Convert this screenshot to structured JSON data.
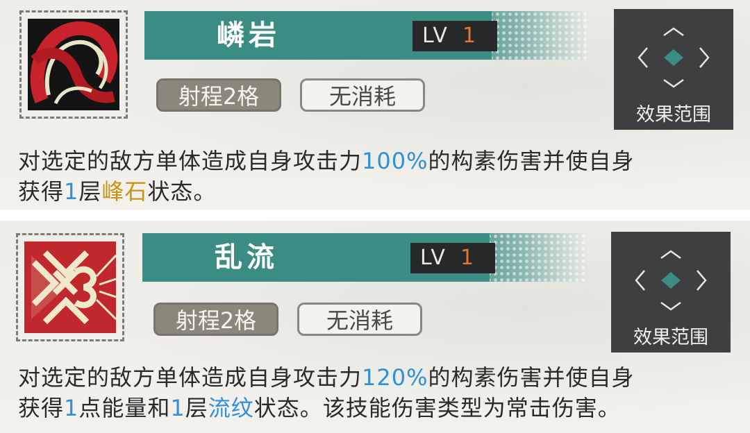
{
  "colors": {
    "banner": "#3b8c83",
    "highlight_blue": "#2f8fd8",
    "highlight_gold": "#c79513",
    "level_value": "#e5752f",
    "range_tile": "#3b8c83"
  },
  "skills": [
    {
      "icon": "red-swirl-icon",
      "name": "嶙岩",
      "level_label": "LV",
      "level_value": "1",
      "tags": {
        "range": "射程2格",
        "cost": "无消耗"
      },
      "range_label": "效果范围",
      "description": {
        "line1_part1": "对选定的敌方单体造成自身攻击力",
        "line1_pct": "100%",
        "line1_part2": "的构素伤害并使自身",
        "line2_part1": "获得",
        "line2_num": "1",
        "line2_part2": "层",
        "line2_status": "峰石",
        "line2_part3": "状态。"
      }
    },
    {
      "icon": "knot-emblem-icon",
      "name": "乱流",
      "level_label": "LV",
      "level_value": "1",
      "tags": {
        "range": "射程2格",
        "cost": "无消耗"
      },
      "range_label": "效果范围",
      "description": {
        "line1_part1": "对选定的敌方单体造成自身攻击力",
        "line1_pct": "120%",
        "line1_part2": "的构素伤害并使自身",
        "line2_part1": "获得",
        "line2_num1": "1",
        "line2_part2": "点能量和",
        "line2_num2": "1",
        "line2_part3": "层",
        "line2_status": "流纹",
        "line2_part4": "状态。该技能伤害类型为常击伤害。"
      }
    }
  ]
}
